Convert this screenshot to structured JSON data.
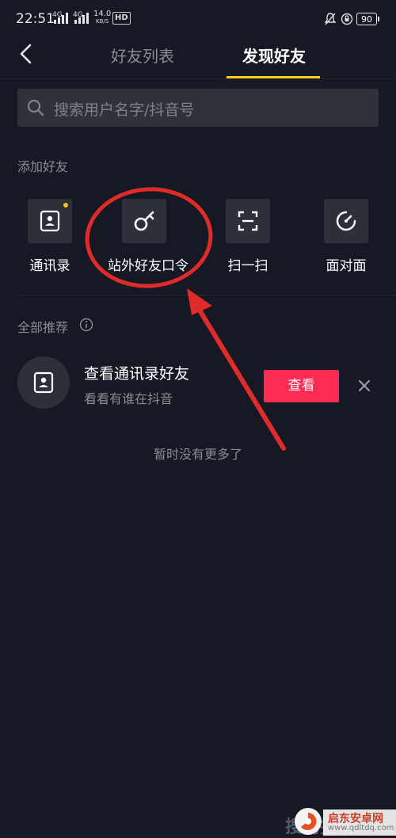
{
  "status_bar": {
    "time": "22:51",
    "sig1": "4G",
    "sig2": "4G",
    "speed_value": "14.0",
    "speed_unit": "KB/S",
    "hd": "HD",
    "battery": "90"
  },
  "header": {
    "tabs": [
      {
        "label": "好友列表",
        "active": false
      },
      {
        "label": "发现好友",
        "active": true
      }
    ]
  },
  "search": {
    "placeholder": "搜索用户名字/抖音号"
  },
  "add_friends": {
    "title": "添加好友",
    "items": [
      {
        "label": "通讯录",
        "icon": "contacts-icon"
      },
      {
        "label": "站外好友口令",
        "icon": "key-icon"
      },
      {
        "label": "扫一扫",
        "icon": "scan-icon"
      },
      {
        "label": "面对面",
        "icon": "face-to-face-icon"
      }
    ]
  },
  "recommend": {
    "title": "全部推荐",
    "item": {
      "title": "查看通讯录好友",
      "subtitle": "看看有谁在抖音",
      "button": "查看"
    },
    "empty_text": "暂时没有更多了"
  },
  "watermarks": {
    "sogou": "搜狗指南",
    "site_cn": "启东安卓网",
    "site_url": "www.qdltdq.com"
  },
  "colors": {
    "background": "#161823",
    "accent_tab": "#face15",
    "button_red": "#fe2c55",
    "annotation_red": "#e02b2b"
  }
}
